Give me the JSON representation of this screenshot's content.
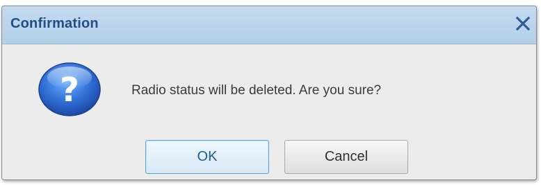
{
  "dialog": {
    "title": "Confirmation",
    "message": "Radio status will be deleted. Are you sure?",
    "icon": "question-icon",
    "close_icon": "close-icon",
    "buttons": {
      "ok_label": "OK",
      "cancel_label": "Cancel"
    }
  },
  "colors": {
    "titlebar_bg": "#bcd5ec",
    "title_text": "#1f4f86",
    "body_bg": "#ececec",
    "ok_border": "#5aa3d9",
    "icon_blue": "#2f6fd6"
  }
}
